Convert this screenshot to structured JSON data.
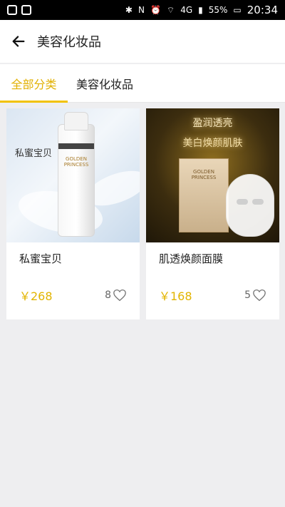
{
  "status": {
    "network": "4G",
    "battery": "55%",
    "time": "20:34"
  },
  "app_bar": {
    "title": "美容化妆品"
  },
  "tabs": [
    {
      "label": "全部分类"
    },
    {
      "label": "美容化妆品"
    }
  ],
  "products": [
    {
      "name": "私蜜宝贝",
      "price": "￥268",
      "likes": "8",
      "image_text": "私蜜宝贝",
      "image_brand": "GOLDEN PRINCESS"
    },
    {
      "name": "肌透焕颜面膜",
      "price": "￥168",
      "likes": "5",
      "image_title": "盈润透亮",
      "image_subtitle": "美白焕颜肌肤",
      "image_brand": "GOLDEN PRINCESS"
    }
  ],
  "colors": {
    "accent": "#f2c200",
    "price": "#e2b400"
  },
  "icons": {
    "back": "arrow-left-icon",
    "like": "heart-outline-icon"
  }
}
